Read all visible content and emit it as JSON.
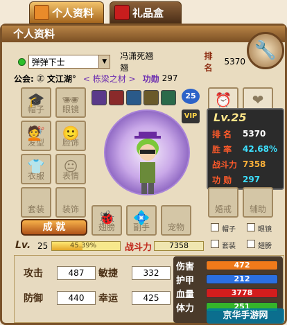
{
  "tabs": [
    {
      "label": "个人资料",
      "icon": "scroll-icon",
      "active": true
    },
    {
      "label": "礼品盒",
      "icon": "gift-icon",
      "active": false
    }
  ],
  "panel_title": "个人资料",
  "status_select": "弹弹下士",
  "player_name": "冯潇死翘翘",
  "rank_label": "排名",
  "rank_value": "5370",
  "guild_label": "公会:",
  "guild_name": "文江湖°",
  "guild_motto": "< 栋梁之材 >",
  "merit_label": "功勋",
  "merit_value": "297",
  "equip_slots": [
    "帽子",
    "眼镜",
    "发型",
    "脸饰",
    "衣服",
    "表情",
    "套装",
    "装饰",
    "翅膀",
    "副手",
    "宠物",
    "婚戒",
    "辅助"
  ],
  "buff_numbers": [
    "25",
    "VIP"
  ],
  "stat_card": {
    "level": "Lv.25",
    "rows": [
      {
        "label": "排  名",
        "value": "5370"
      },
      {
        "label": "胜  率",
        "value": "42.68%"
      },
      {
        "label": "战斗力",
        "value": "7358"
      },
      {
        "label": "功  勋",
        "value": "297"
      }
    ]
  },
  "achievement_button": "成 就",
  "checkboxes": [
    "帽子",
    "眼镜",
    "套装",
    "翅膀"
  ],
  "level_label": "Lv.",
  "level_value": "25",
  "exp_percent": "45.39%",
  "exp_fraction": 0.4539,
  "power_label": "战斗力",
  "power_value": "7358",
  "attributes": [
    {
      "label": "攻击",
      "value": "487"
    },
    {
      "label": "敏捷",
      "value": "332"
    },
    {
      "label": "防御",
      "value": "440"
    },
    {
      "label": "幸运",
      "value": "425"
    }
  ],
  "bars": [
    {
      "label": "伤害",
      "value": "472",
      "color": "#f07a1a"
    },
    {
      "label": "护甲",
      "value": "212",
      "color": "#2b6fe0"
    },
    {
      "label": "血量",
      "value": "3778",
      "color": "#d21d1d"
    },
    {
      "label": "体力",
      "value": "251",
      "color": "#35b52a"
    }
  ],
  "watermark": "京华手游网"
}
